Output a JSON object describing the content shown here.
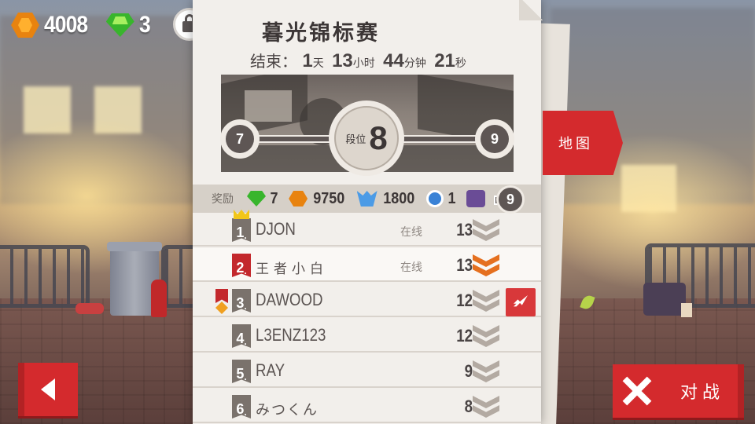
{
  "currency": {
    "coins": "4008",
    "gems": "3"
  },
  "tournament": {
    "title": "暮光锦标赛",
    "ends_label": "结束：",
    "time": {
      "days": "1",
      "days_unit": "天",
      "hours": "13",
      "hours_unit": "小时",
      "minutes": "44",
      "minutes_unit": "分钟",
      "seconds": "21",
      "seconds_unit": "秒"
    }
  },
  "rank": {
    "previous": "7",
    "current_label": "段位",
    "current": "8",
    "next": "9"
  },
  "rewards": {
    "label": "奖励",
    "gems": "7",
    "coins": "9750",
    "shards": "1800",
    "tokens": "1",
    "next_rank": "9"
  },
  "map_tab": {
    "label": "地图"
  },
  "leaderboard": [
    {
      "pos": "1",
      "name": "DJON",
      "status": "在线",
      "score": "13"
    },
    {
      "pos": "2",
      "name": "王者小白",
      "status": "在线",
      "score": "13"
    },
    {
      "pos": "3",
      "name": "DAWOOD",
      "status": "",
      "score": "12"
    },
    {
      "pos": "4",
      "name": "L3ENZ123",
      "status": "",
      "score": "12"
    },
    {
      "pos": "5",
      "name": "RAY",
      "status": "",
      "score": "9"
    },
    {
      "pos": "6",
      "name": "みつくん",
      "status": "",
      "score": "8"
    }
  ],
  "buttons": {
    "battle_label": "对战"
  },
  "colors": {
    "accent_red": "#d42a2d",
    "coin_orange": "#e8830f",
    "gem_green": "#38b52c",
    "panel": "#f2efeb"
  }
}
